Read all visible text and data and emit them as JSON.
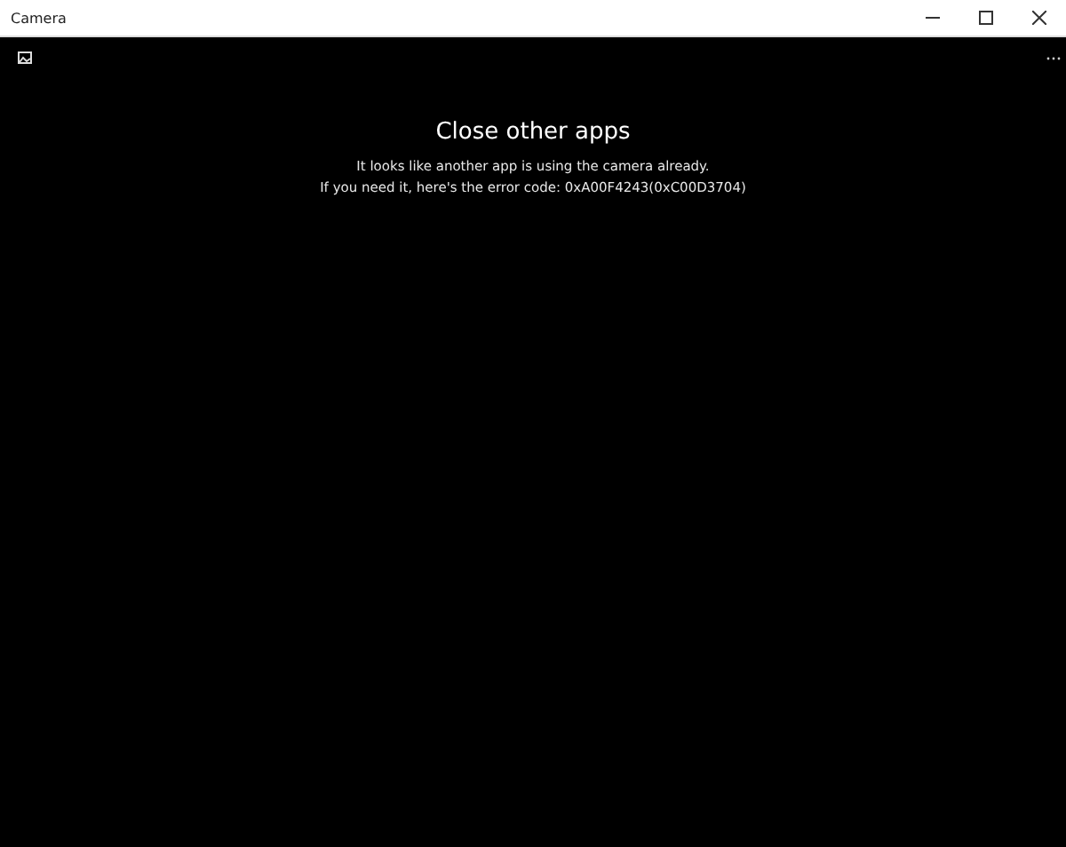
{
  "window": {
    "title": "Camera"
  },
  "message": {
    "heading": "Close other apps",
    "lines": [
      "It looks like another app is using the camera already.",
      "If you need it, here's the error code: 0xA00F4243(0xC00D3704)"
    ]
  }
}
